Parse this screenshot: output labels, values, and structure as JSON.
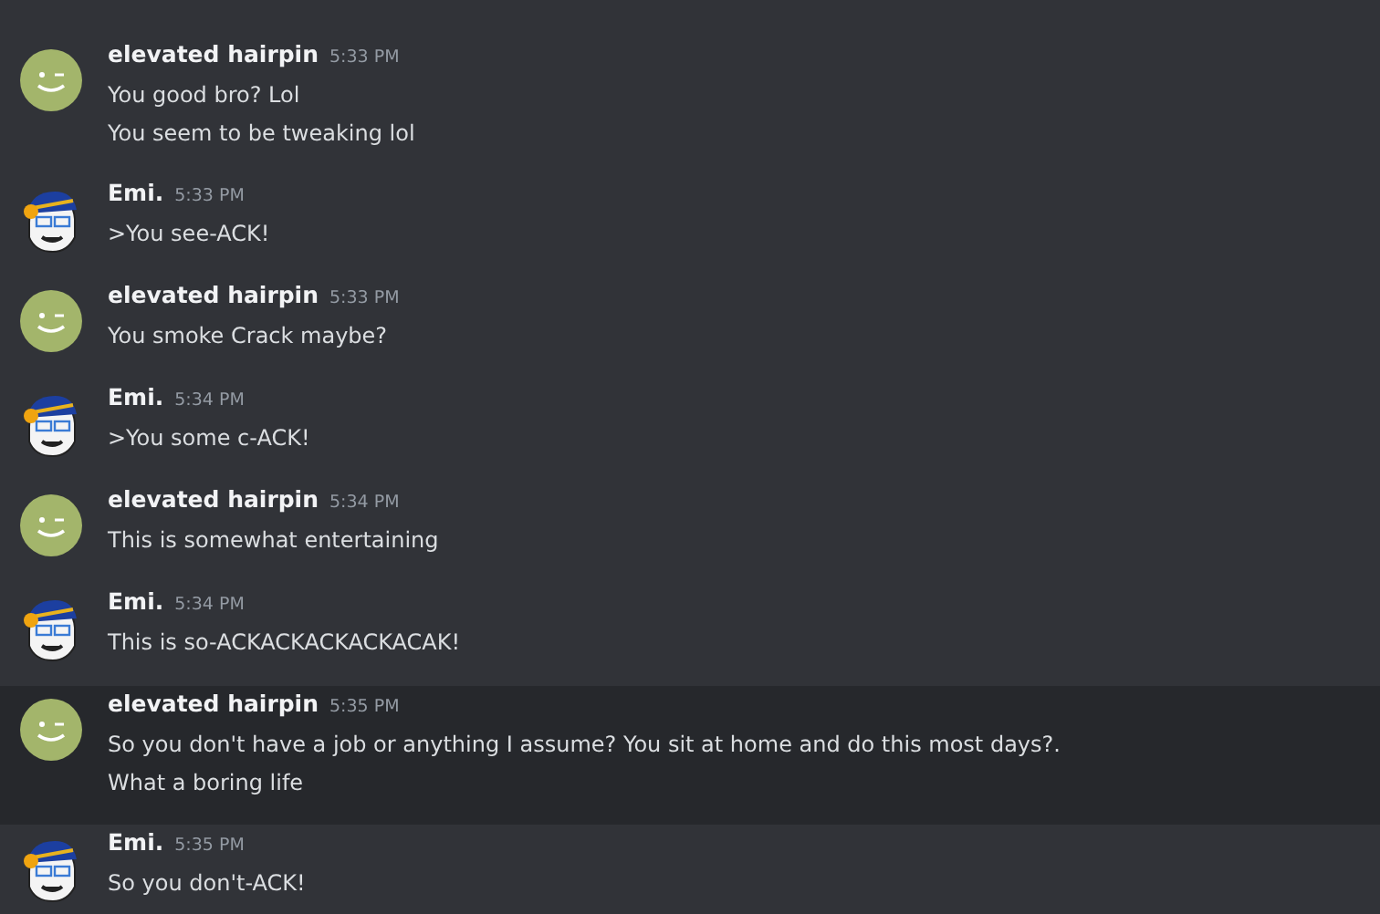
{
  "messages": [
    {
      "author": "elevated hairpin",
      "kind": "smiley",
      "time": "5:33 PM",
      "highlighted": false,
      "lines": [
        "You good bro? Lol",
        "You seem to be tweaking lol"
      ]
    },
    {
      "author": "Emi.",
      "kind": "character",
      "time": "5:33 PM",
      "highlighted": false,
      "lines": [
        ">You see-ACK!"
      ]
    },
    {
      "author": "elevated hairpin",
      "kind": "smiley",
      "time": "5:33 PM",
      "highlighted": false,
      "lines": [
        "You smoke Crack maybe?"
      ]
    },
    {
      "author": "Emi.",
      "kind": "character",
      "time": "5:34 PM",
      "highlighted": false,
      "lines": [
        ">You some c-ACK!"
      ]
    },
    {
      "author": "elevated hairpin",
      "kind": "smiley",
      "time": "5:34 PM",
      "highlighted": false,
      "lines": [
        "This is somewhat entertaining"
      ]
    },
    {
      "author": "Emi.",
      "kind": "character",
      "time": "5:34 PM",
      "highlighted": false,
      "lines": [
        "This is so-ACKACKACKACKACAK!"
      ]
    },
    {
      "author": "elevated hairpin",
      "kind": "smiley",
      "time": "5:35 PM",
      "highlighted": true,
      "lines": [
        "So you don't have a job or anything I assume? You sit at home and do this most days?.",
        "What a boring life"
      ]
    },
    {
      "author": "Emi.",
      "kind": "character",
      "time": "5:35 PM",
      "highlighted": false,
      "lines": [
        "So you don't-ACK!"
      ]
    }
  ]
}
